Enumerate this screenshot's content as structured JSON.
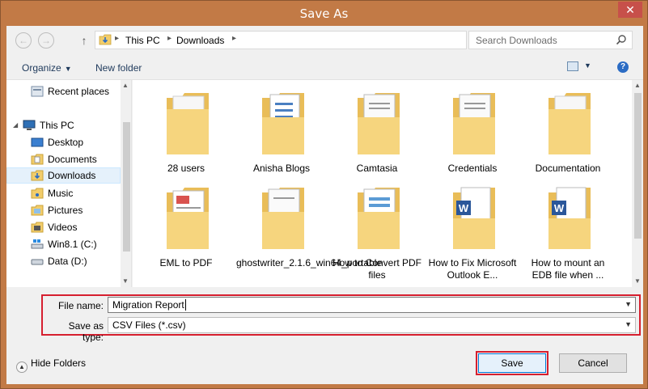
{
  "window": {
    "title": "Save As",
    "close_glyph": "✕"
  },
  "address": {
    "crumbs": [
      "This PC",
      "Downloads"
    ],
    "search_placeholder": "Search Downloads"
  },
  "toolbar": {
    "organize": "Organize",
    "new_folder": "New folder"
  },
  "nav": {
    "items": [
      {
        "label": "Recent places",
        "icon": "recent-places-icon"
      },
      {
        "label": "This PC",
        "icon": "computer-icon"
      },
      {
        "label": "Desktop",
        "icon": "desktop-icon"
      },
      {
        "label": "Documents",
        "icon": "documents-icon"
      },
      {
        "label": "Downloads",
        "icon": "downloads-icon",
        "selected": true
      },
      {
        "label": "Music",
        "icon": "music-icon"
      },
      {
        "label": "Pictures",
        "icon": "pictures-icon"
      },
      {
        "label": "Videos",
        "icon": "videos-icon"
      },
      {
        "label": "Win8.1 (C:)",
        "icon": "drive-c-icon"
      },
      {
        "label": "Data (D:)",
        "icon": "drive-d-icon"
      }
    ]
  },
  "files": [
    {
      "name": "28 users",
      "kind": "plain"
    },
    {
      "name": "Anisha Blogs",
      "kind": "docs"
    },
    {
      "name": "Camtasia",
      "kind": "docs"
    },
    {
      "name": "Credentials",
      "kind": "docs"
    },
    {
      "name": "Documentation",
      "kind": "plain"
    },
    {
      "name": "EML to PDF",
      "kind": "pdf"
    },
    {
      "name": "ghostwriter_2.1.6_win64_portable",
      "kind": "docs"
    },
    {
      "name": "How to Convert PDF files",
      "kind": "docs"
    },
    {
      "name": "How to Fix Microsoft Outlook E...",
      "kind": "word"
    },
    {
      "name": "How to mount an EDB file when ...",
      "kind": "word"
    }
  ],
  "form": {
    "file_name_label": "File name:",
    "file_name_value": "Migration Report",
    "save_type_label": "Save as type:",
    "save_type_value": "CSV Files (*.csv)"
  },
  "footer": {
    "hide_folders": "Hide Folders",
    "save": "Save",
    "cancel": "Cancel"
  },
  "colors": {
    "title_bar": "#c27a46",
    "highlight": "#d61f2f",
    "folder": "#f4d27a"
  }
}
